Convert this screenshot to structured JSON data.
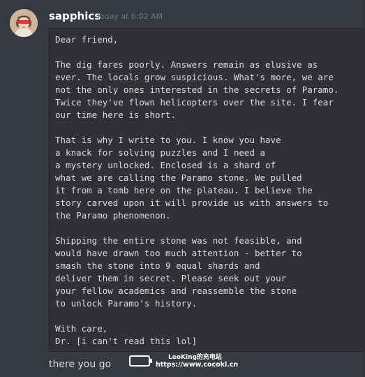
{
  "message": {
    "author": "sapphics",
    "timestamp": "Today at 6:02 AM",
    "code_text": "Dear friend,\n\nThe dig fares poorly. Answers remain as elusive as\never. The locals grow suspicious. What's more, we are\nnot the only ones interested in the secrets of Paramo.\nTwice they've flown helicopters over the site. I fear\nour time here is short.\n\nThat is why I write to you. I know you have\na knack for solving puzzles and I need a\na mystery unlocked. Enclosed is a shard of\nwhat we are calling the Paramo stone. We pulled\nit from a tomb here on the plateau. I believe the\nstory carved upon it will provide us with answers to\nthe Paramo phenomenon.\n\nShipping the entire stone was not feasible, and\nwould have drawn too much attention - better to\nsmash the stone into 9 equal shards and\ndeliver them in secret. Please seek out your\nyour fellow academics and reassemble the stone\nto unlock Paramo's history.\n\nWith care,\nDr. [i can't read this lol]",
    "followup": "there you go"
  },
  "watermark": {
    "name": "LeoKing的充电站",
    "url": "https://www.cocokl.cn",
    "icon": "battery-icon"
  },
  "colors": {
    "background": "#36393f",
    "codeblock_bg": "#2f3136",
    "username": "#ffffff",
    "timestamp": "#72767d",
    "text": "#dcddde"
  }
}
